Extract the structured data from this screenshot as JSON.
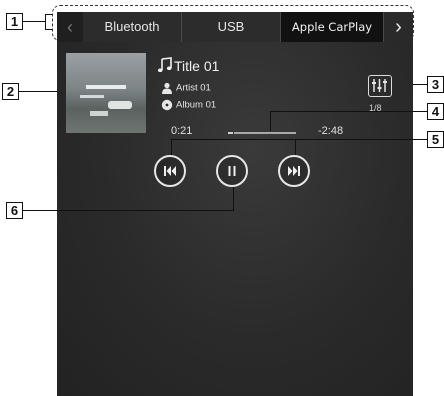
{
  "callouts": [
    "1",
    "2",
    "3",
    "4",
    "5",
    "6"
  ],
  "tabs": [
    {
      "label": "Bluetooth",
      "active": false
    },
    {
      "label": "USB",
      "active": false
    },
    {
      "label": "Apple CarPlay",
      "active": true
    }
  ],
  "nav": {
    "prev_icon": "chevron-left-icon",
    "next_icon": "chevron-right-icon"
  },
  "track": {
    "title": "Title 01",
    "artist": "Artist 01",
    "album": "Album 01",
    "position": "1/8",
    "elapsed": "0:21",
    "remaining": "-2:48",
    "progress_fraction": 0.11
  },
  "controls": {
    "previous_icon": "skip-previous-icon",
    "pause_icon": "pause-icon",
    "next_icon": "skip-next-icon",
    "sound_settings_icon": "equalizer-icon"
  },
  "colors": {
    "screen_bg": "#2a2a2a",
    "text": "#f2f2f2",
    "tab_active": "#111111"
  }
}
